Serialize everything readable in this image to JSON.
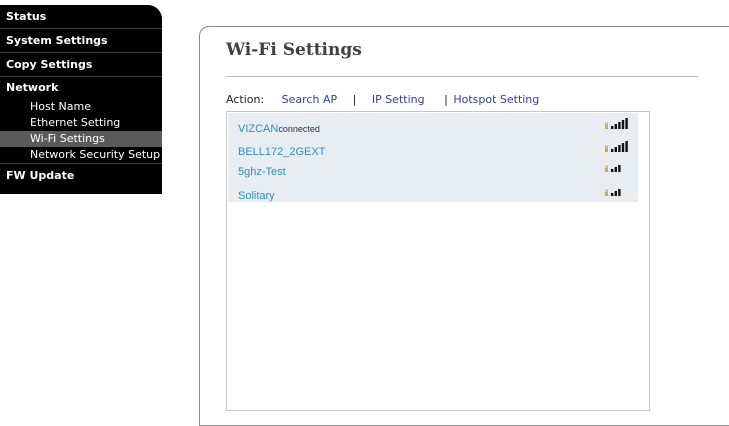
{
  "sidebar": {
    "status": "Status",
    "system_settings": "System Settings",
    "copy_settings": "Copy Settings",
    "network": "Network",
    "network_items": [
      {
        "label": "Host Name"
      },
      {
        "label": "Ethernet Setting"
      },
      {
        "label": "Wi-Fi Settings",
        "active": true
      },
      {
        "label": "Network Security Setup"
      }
    ],
    "fw_update": "FW Update"
  },
  "main": {
    "title": "Wi-Fi Settings",
    "action_label": "Action:",
    "actions": {
      "search_ap": "Search AP",
      "ip_setting": "IP Setting",
      "hotspot_setting": "Hotspot Setting"
    },
    "access_points": [
      {
        "name": "VIZCAN",
        "status": "connected",
        "signal_bars": 5
      },
      {
        "name": "BELL172_2GEXT",
        "status": "",
        "signal_bars": 5
      },
      {
        "name": "5ghz-Test",
        "status": "",
        "signal_bars": 3
      },
      {
        "name": "Solitary",
        "status": "",
        "signal_bars": 3
      }
    ]
  },
  "colors": {
    "sidebar_bg": "#000000",
    "sidebar_active": "#5a5a5a",
    "link": "#2d3fa8",
    "ap_name": "#2f8fc8",
    "list_bg": "#e8edf2",
    "lock_icon": "#d9a441"
  }
}
